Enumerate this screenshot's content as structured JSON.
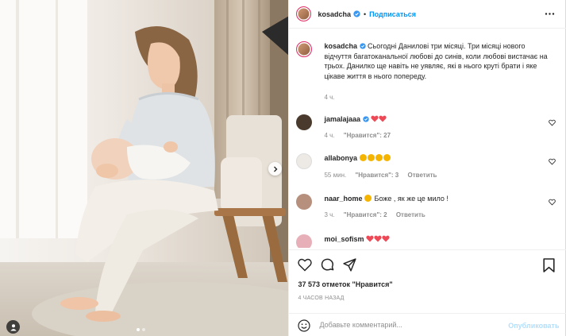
{
  "post": {
    "author": "kosadcha",
    "follow_label": "Подписаться",
    "separator": "•",
    "caption": "Сьогодні Данилові три місяці. Три місяці нового відчуття багатоканальної любові до синів, коли любові вистачає на трьох. Данилко ще навіть не уявляє, які в нього круті брати і яке цікаве життя в нього попереду.",
    "caption_age": "4 ч.",
    "media": {
      "slide_count": 2,
      "active_slide": 1
    }
  },
  "comments": [
    {
      "user": "jamalajaaa",
      "verified": true,
      "text_emojis": [
        "red-heart",
        "red-heart"
      ],
      "text": "",
      "age": "4 ч.",
      "likes_label": "\"Нравится\": 27",
      "reply_label": ""
    },
    {
      "user": "allabonya",
      "verified": false,
      "text_emojis": [
        "heart-eyes",
        "heart-eyes",
        "heart-eyes",
        "heart-eyes"
      ],
      "text": "",
      "age": "55 мин.",
      "likes_label": "\"Нравится\": 3",
      "reply_label": "Ответить"
    },
    {
      "user": "naar_home",
      "verified": false,
      "text_emojis": [
        "heart-eyes"
      ],
      "text": "Боже , як же це мило !",
      "age": "3 ч.",
      "likes_label": "\"Нравится\": 2",
      "reply_label": "Ответить"
    },
    {
      "user": "moi_sofism",
      "verified": false,
      "text_emojis": [
        "red-heart",
        "red-heart",
        "red-heart"
      ],
      "text": "",
      "age": "",
      "likes_label": "",
      "reply_label": ""
    }
  ],
  "stats": {
    "likes": "37 573 отметок \"Нравится\"",
    "posted": "4 ЧАСОВ НАЗАД"
  },
  "composer": {
    "placeholder": "Добавьте комментарий...",
    "publish_label": "Опубликовать"
  },
  "colors": {
    "link_blue": "#0095f6",
    "publish_disabled": "#b2dffc",
    "heart_red": "#ed4956",
    "muted": "#8e8e8e"
  },
  "icons": [
    "verified-badge-icon",
    "more-options-icon",
    "like-icon",
    "comment-icon",
    "share-icon",
    "bookmark-icon",
    "emoji-icon",
    "next-slide-icon",
    "user-tag-icon"
  ]
}
